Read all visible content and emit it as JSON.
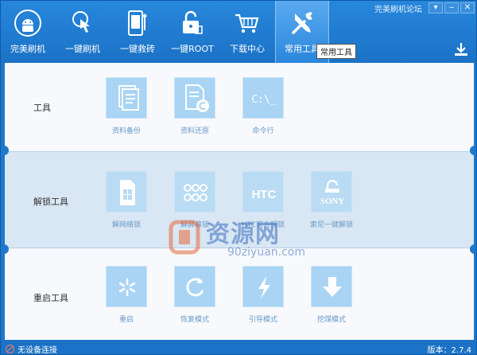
{
  "titlebar": {
    "forum_link": "完美刷机论坛",
    "dropdown": "▾",
    "close": "✕"
  },
  "nav": {
    "items": [
      {
        "label": "完美刷机",
        "icon": "android-icon"
      },
      {
        "label": "一键刷机",
        "icon": "touch-icon"
      },
      {
        "label": "一键救砖",
        "icon": "phone-repair-icon"
      },
      {
        "label": "一键ROOT",
        "icon": "unlock-icon"
      },
      {
        "label": "下载中心",
        "icon": "cart-icon"
      },
      {
        "label": "常用工具",
        "icon": "tools-icon",
        "active": true
      }
    ],
    "tooltip": "常用工具"
  },
  "sections": {
    "tools": {
      "title": "工具",
      "items": [
        {
          "label": "资料备份",
          "icon": "document-backup-icon"
        },
        {
          "label": "资料还原",
          "icon": "document-restore-icon"
        },
        {
          "label": "命令行",
          "icon": "terminal-icon",
          "glyph": "C:\\_"
        }
      ]
    },
    "unlock": {
      "title": "解锁工具",
      "items": [
        {
          "label": "解网络锁",
          "icon": "sim-card-icon"
        },
        {
          "label": "解屏幕锁",
          "icon": "keypad-icon"
        },
        {
          "label": "HTC官方解锁",
          "icon": "htc-icon",
          "glyph": "HTC"
        },
        {
          "label": "索尼一键解锁",
          "icon": "sony-icon",
          "glyph": "SONY"
        }
      ]
    },
    "restart": {
      "title": "重启工具",
      "items": [
        {
          "label": "重启",
          "icon": "restart-icon"
        },
        {
          "label": "恢复模式",
          "icon": "recovery-icon"
        },
        {
          "label": "引导模式",
          "icon": "bolt-icon"
        },
        {
          "label": "挖煤模式",
          "icon": "download-arrow-icon"
        }
      ]
    }
  },
  "watermark": {
    "text": "资源网",
    "sub": "90ziyuan.com"
  },
  "status": {
    "connection": "无设备连接",
    "version": "版本：2.7.4"
  },
  "colors": {
    "accent": "#1e78cc",
    "tile": "#a9d4f3",
    "label": "#6a9bc9"
  }
}
